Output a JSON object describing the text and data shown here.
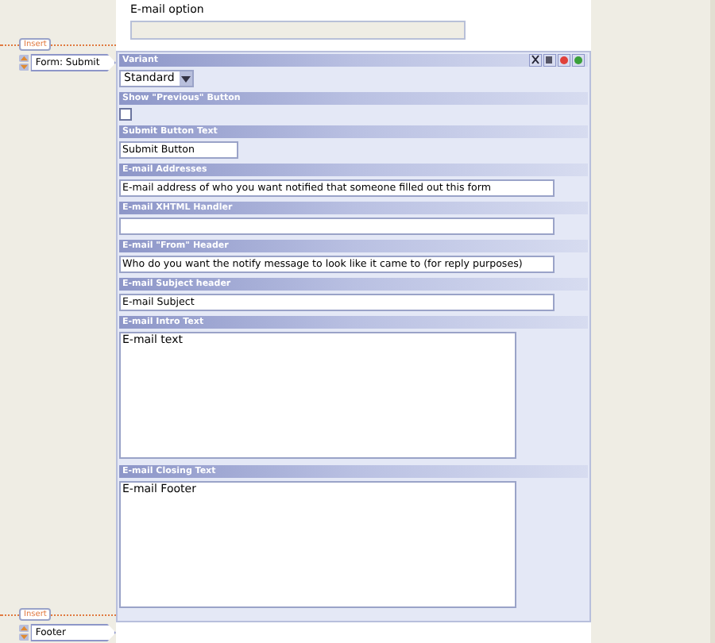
{
  "top_option": {
    "label": "E-mail option"
  },
  "sidebar": {
    "markers": [
      {
        "insert": "Insert",
        "block": "Form: Submit"
      },
      {
        "insert": "Insert",
        "block": "Footer"
      }
    ]
  },
  "sections": [
    {
      "header": "Variant",
      "kind": "select",
      "value": "Standard"
    },
    {
      "header": "Show \"Previous\" Button",
      "kind": "checkbox",
      "checked": false
    },
    {
      "header": "Submit Button Text",
      "kind": "short_input",
      "value": "Submit Button"
    },
    {
      "header": "E-mail Addresses",
      "kind": "input",
      "value": "E-mail address of who you want notified that someone filled out this form"
    },
    {
      "header": "E-mail XHTML Handler",
      "kind": "input"
    },
    {
      "header": "E-mail \"From\" Header",
      "kind": "input",
      "value": "Who do you want the notify message to look like it came to (for reply purposes)"
    },
    {
      "header": "E-mail Subject header",
      "kind": "input",
      "value": "E-mail Subject"
    },
    {
      "header": "E-mail Intro Text",
      "kind": "textarea",
      "value": "E-mail text"
    },
    {
      "header": "E-mail Closing Text",
      "kind": "textarea",
      "value": "E-mail Footer"
    }
  ]
}
